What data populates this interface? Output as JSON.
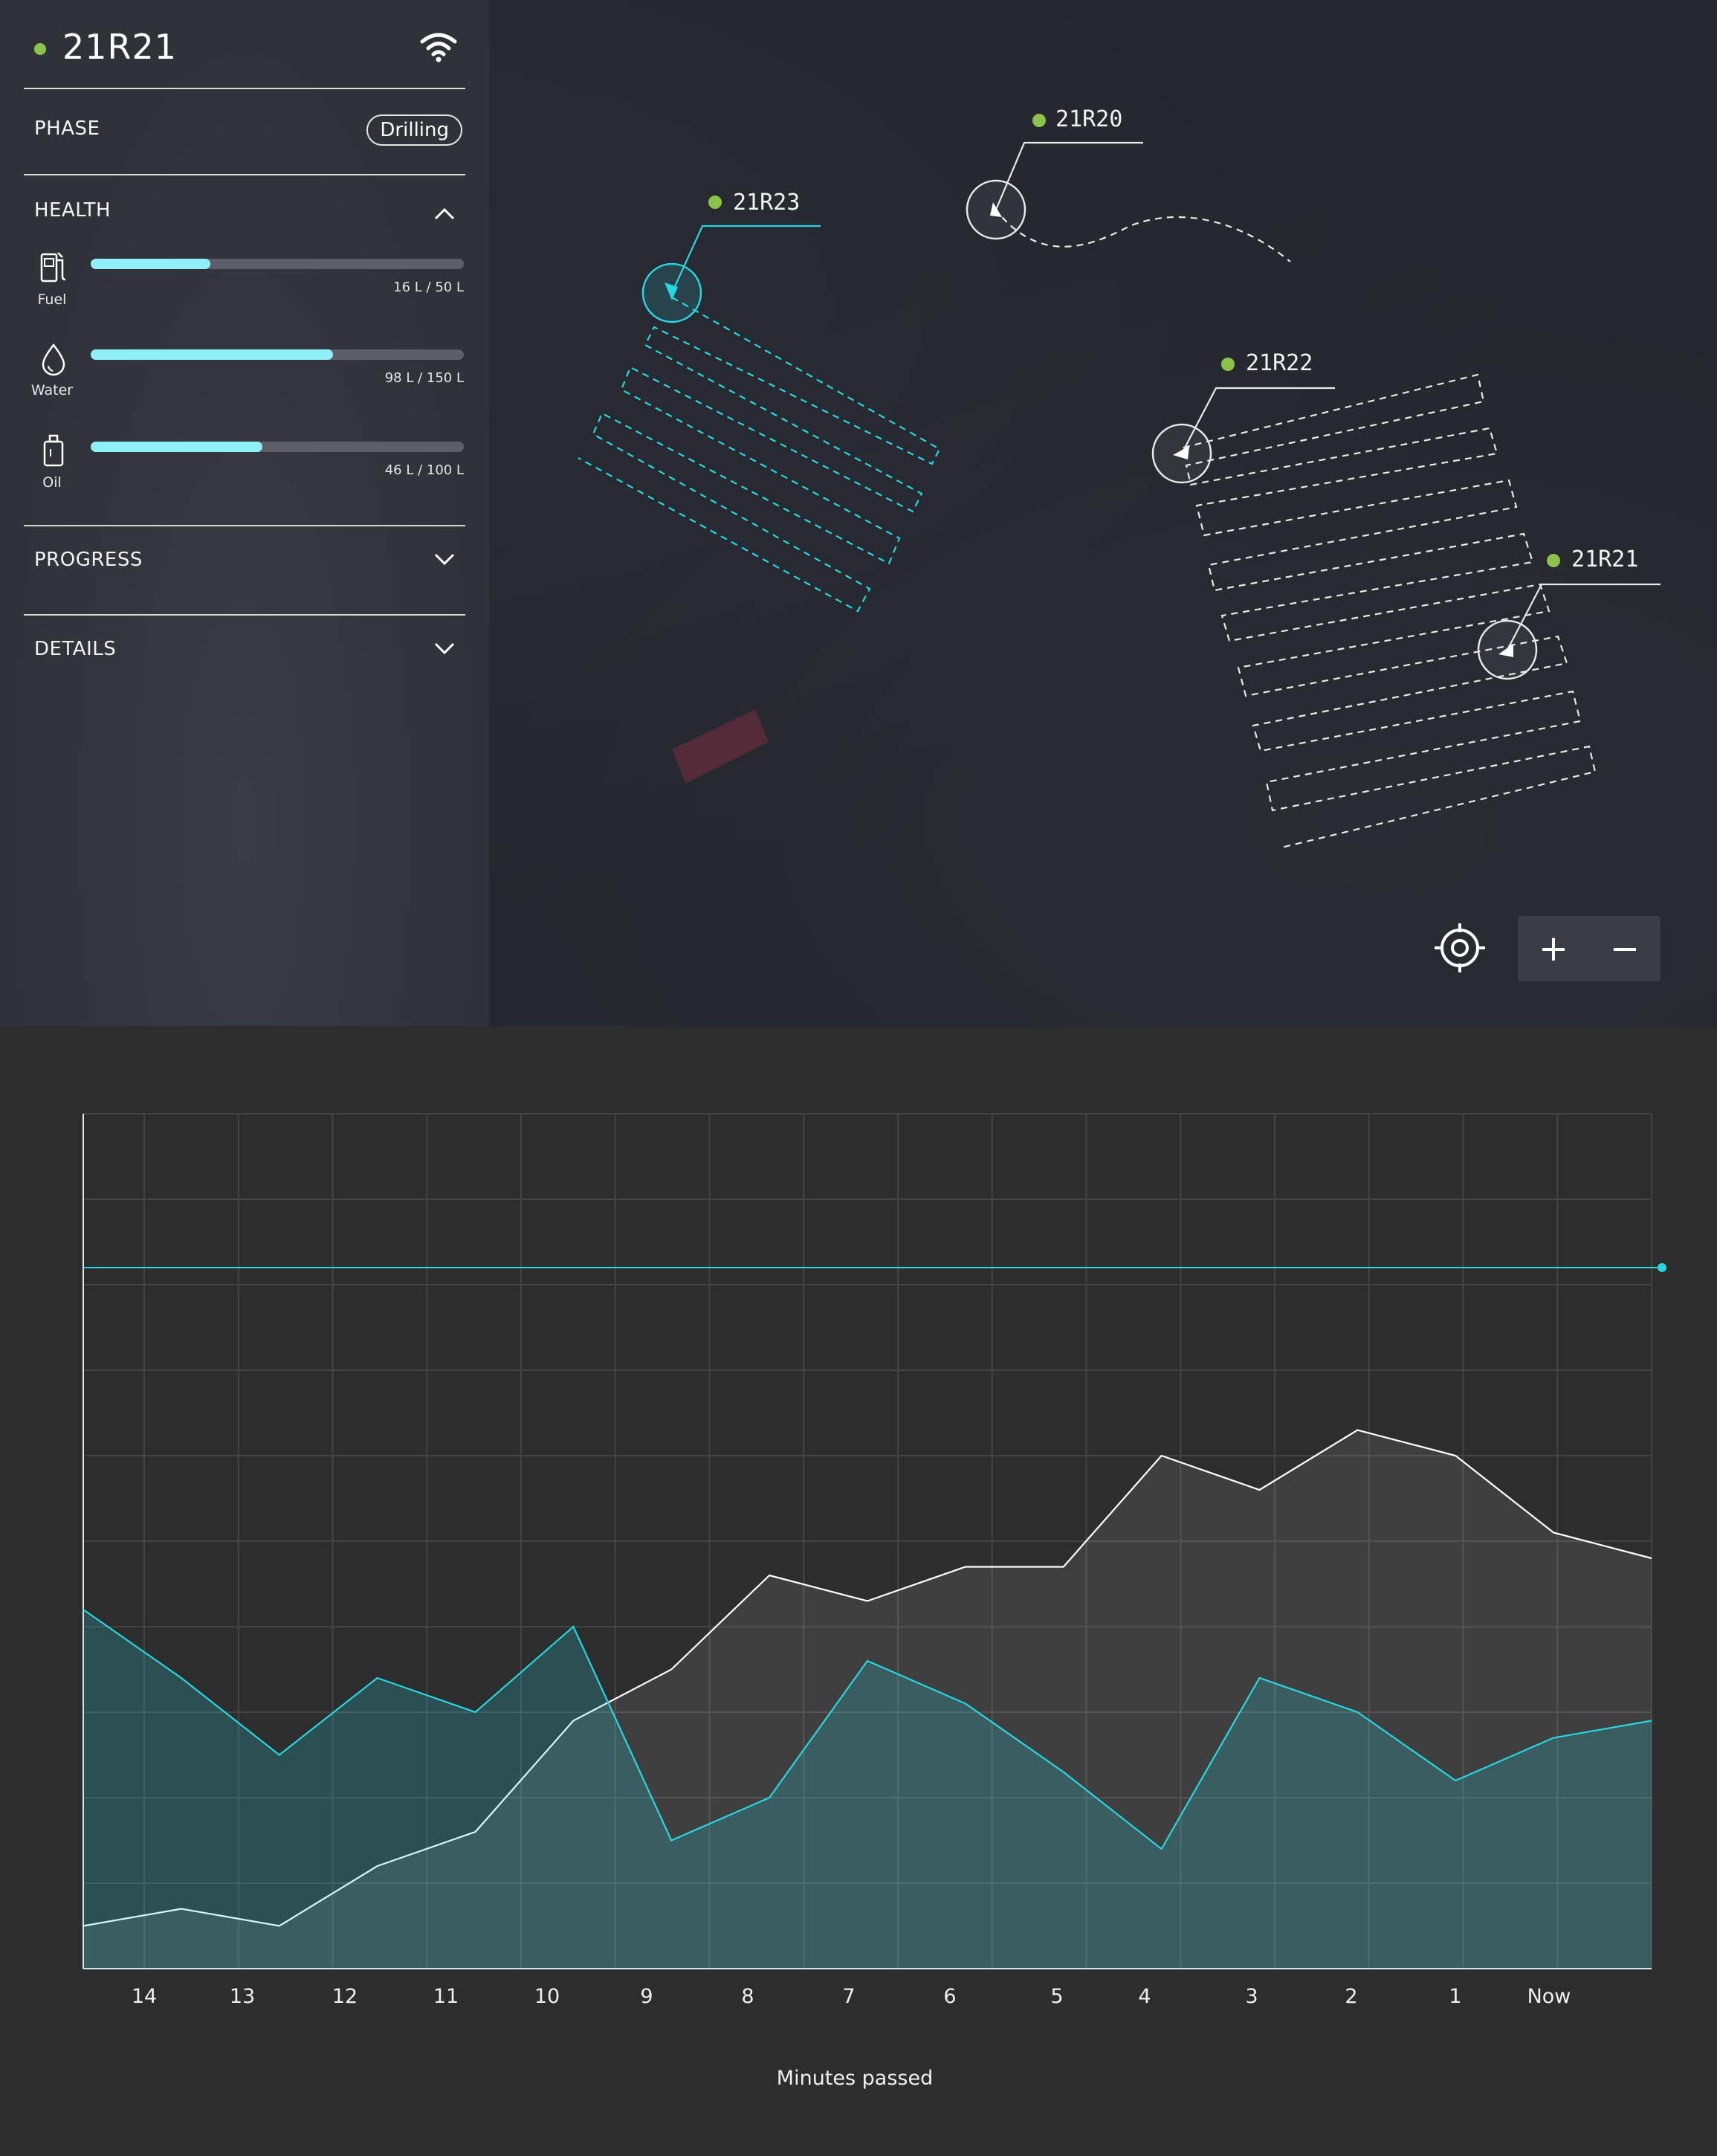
{
  "panel": {
    "title": "21R21",
    "status_color": "#8bc34a",
    "wifi_icon": "wifi-icon",
    "phase_label": "PHASE",
    "phase_value": "Drilling",
    "health_label": "HEALTH",
    "health_expanded": true,
    "metrics": [
      {
        "label": "Fuel",
        "icon": "fuel-icon",
        "value_text": "16 L / 50 L",
        "fraction": 0.32
      },
      {
        "label": "Water",
        "icon": "water-drop-icon",
        "value_text": "98 L / 150 L",
        "fraction": 0.65
      },
      {
        "label": "Oil",
        "icon": "oil-can-icon",
        "value_text": "46 L / 100 L",
        "fraction": 0.46
      }
    ],
    "progress_label": "PROGRESS",
    "details_label": "DETAILS"
  },
  "map": {
    "rovers": [
      {
        "id": "21R23",
        "status_color": "#8bc34a",
        "selected": false
      },
      {
        "id": "21R20",
        "status_color": "#8bc34a",
        "selected": false
      },
      {
        "id": "21R22",
        "status_color": "#8bc34a",
        "selected": false
      },
      {
        "id": "21R21",
        "status_color": "#8bc34a",
        "selected": true
      }
    ],
    "controls": {
      "locate_icon": "crosshair-icon",
      "zoom_in": "+",
      "zoom_out": "−"
    }
  },
  "chart_data": {
    "type": "area",
    "xlabel": "Minutes passed",
    "categories": [
      "14",
      "13",
      "12",
      "11",
      "10",
      "9",
      "8",
      "7",
      "6",
      "5",
      "4",
      "3",
      "2",
      "1",
      "Now"
    ],
    "ylim": [
      0,
      10
    ],
    "grid": true,
    "threshold": 8.2,
    "series": [
      {
        "color": "#ffffff",
        "values": [
          0.5,
          0.7,
          0.5,
          1.2,
          1.6,
          2.9,
          3.5,
          4.6,
          4.3,
          4.7,
          4.7,
          6.0,
          5.6,
          6.3,
          6.0,
          5.1,
          4.8
        ]
      },
      {
        "color": "#26d7e3",
        "values": [
          4.2,
          3.4,
          2.5,
          3.4,
          3.0,
          4.0,
          1.5,
          2.0,
          3.6,
          3.1,
          2.3,
          1.4,
          3.4,
          3.0,
          2.2,
          2.7,
          2.9
        ]
      }
    ],
    "colors": {
      "primary": "#26d7e3",
      "secondary": "#ffffff"
    }
  }
}
